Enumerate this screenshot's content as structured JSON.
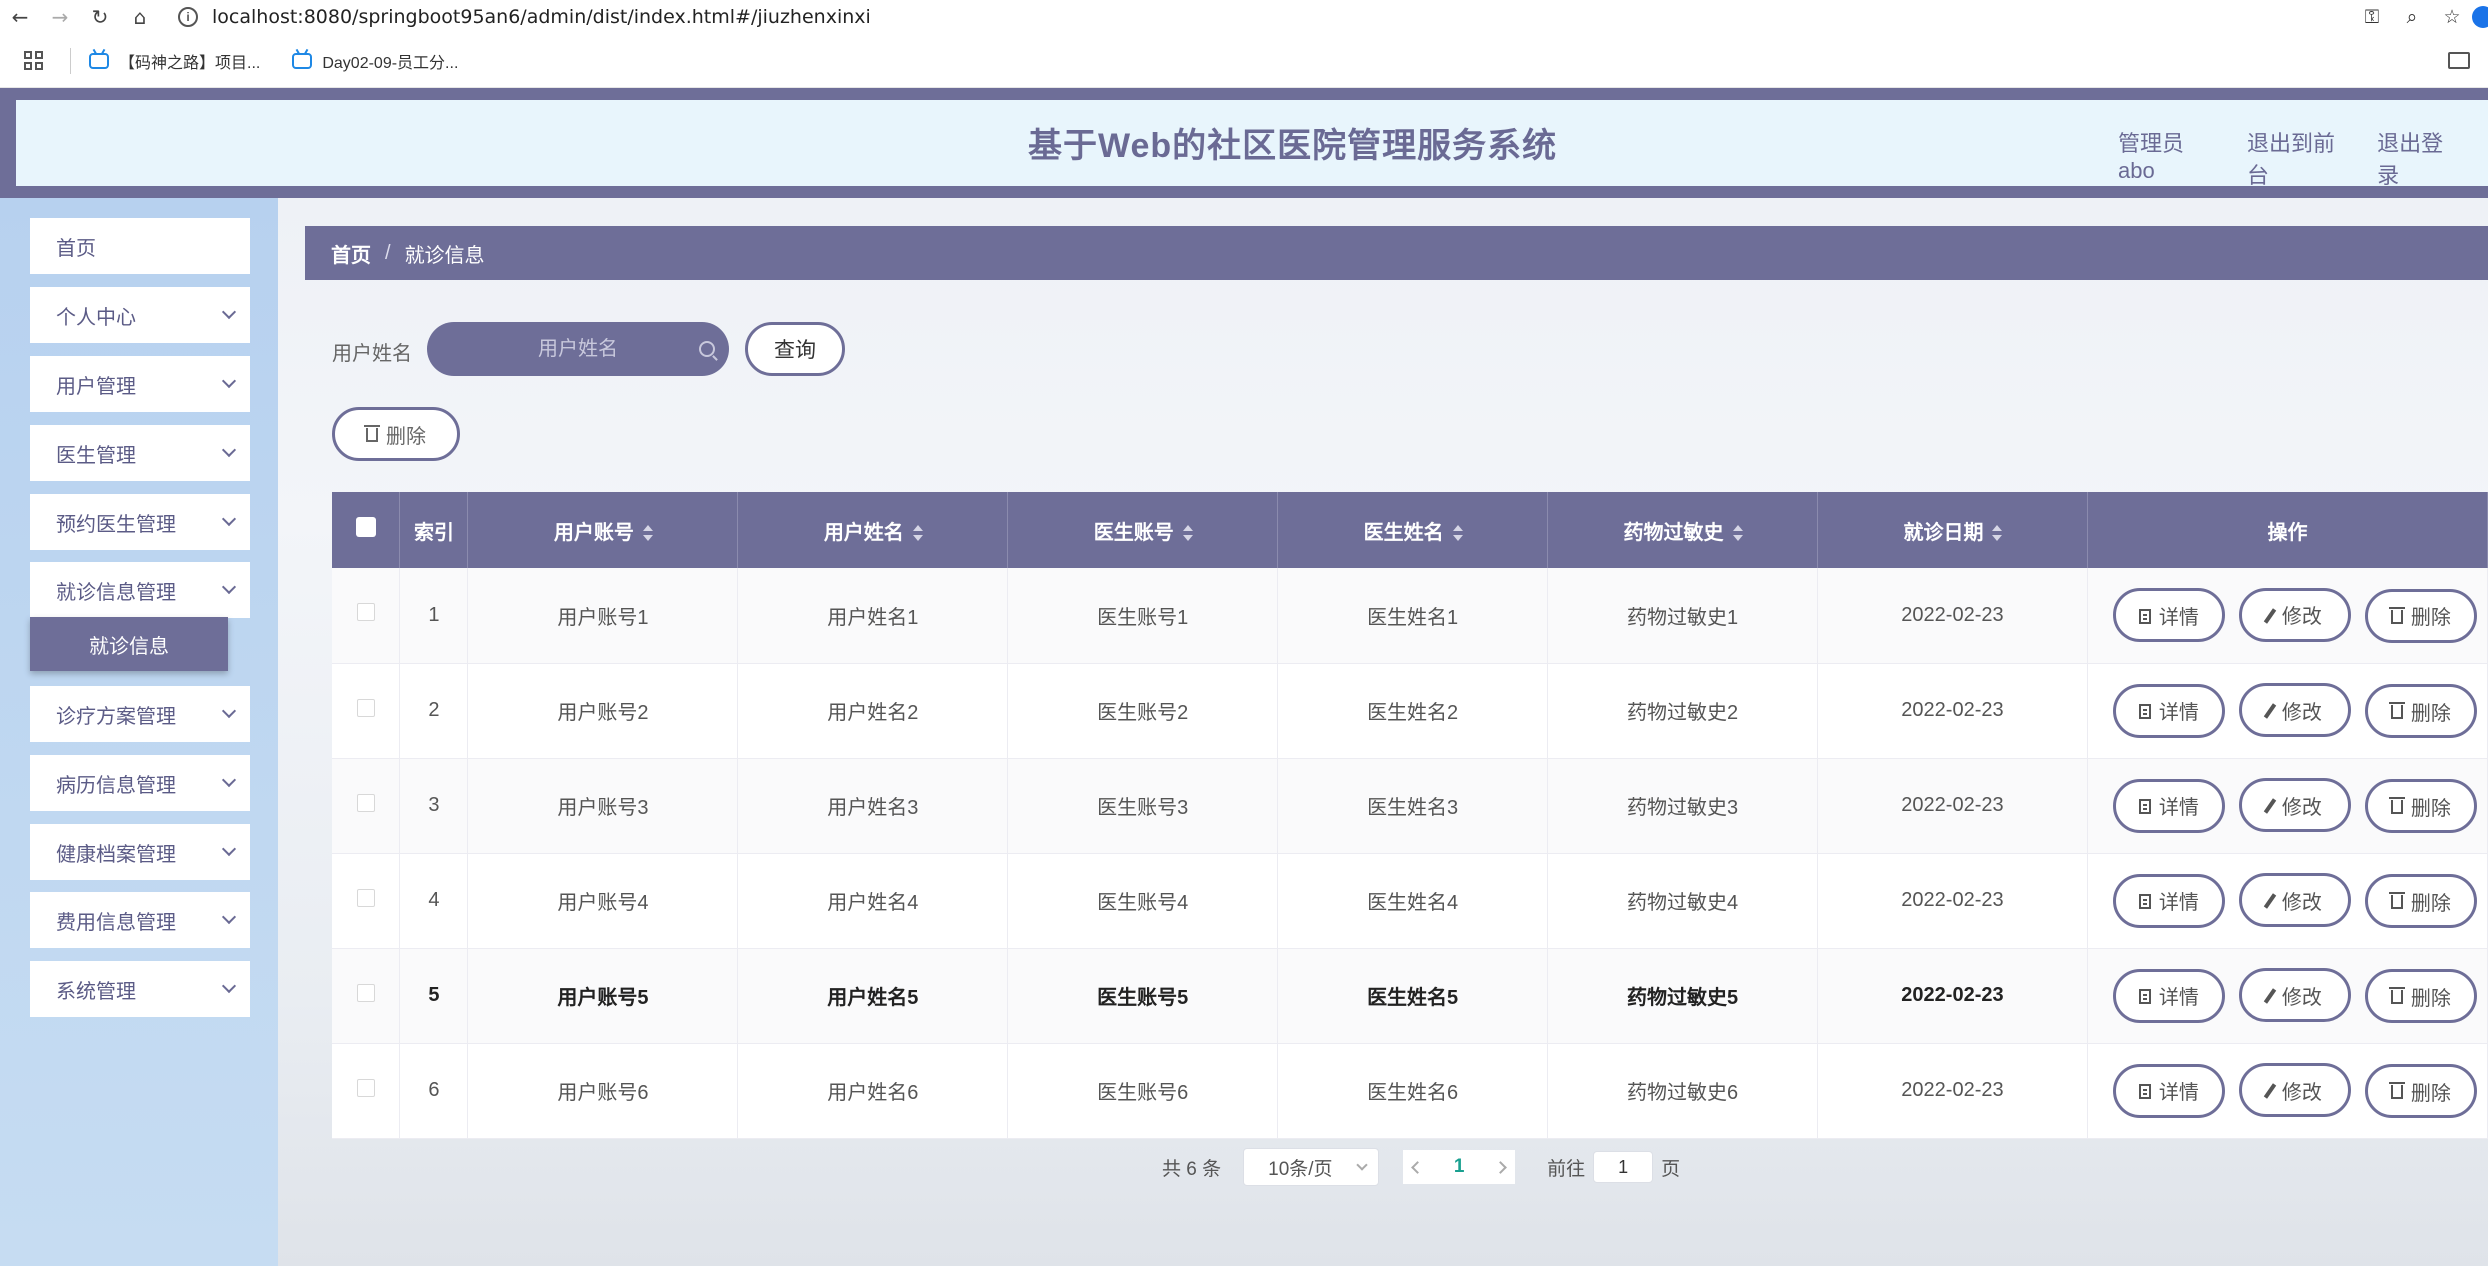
{
  "browser": {
    "url": "localhost:8080/springboot95an6/admin/dist/index.html#/jiuzhenxinxi",
    "bookmarks": [
      "【码神之路】项目...",
      "Day02-09-员工分..."
    ]
  },
  "header": {
    "title": "基于Web的社区医院管理服务系统",
    "admin": "管理员 abo",
    "to_front": "退出到前台",
    "logout": "退出登录"
  },
  "sidebar": {
    "items": [
      {
        "label": "首页"
      },
      {
        "label": "个人中心"
      },
      {
        "label": "用户管理"
      },
      {
        "label": "医生管理"
      },
      {
        "label": "预约医生管理"
      },
      {
        "label": "就诊信息管理"
      },
      {
        "label": "诊疗方案管理"
      },
      {
        "label": "病历信息管理"
      },
      {
        "label": "健康档案管理"
      },
      {
        "label": "费用信息管理"
      },
      {
        "label": "系统管理"
      }
    ],
    "active_sub": "就诊信息"
  },
  "breadcrumb": {
    "home": "首页",
    "sep": "/",
    "current": "就诊信息"
  },
  "search": {
    "label": "用户姓名",
    "placeholder": "用户姓名",
    "query_btn": "查询"
  },
  "actions": {
    "batch_delete": "删除"
  },
  "table": {
    "headers": [
      "索引",
      "用户账号",
      "用户姓名",
      "医生账号",
      "医生姓名",
      "药物过敏史",
      "就诊日期",
      "操作"
    ],
    "ops": {
      "detail": "详情",
      "edit": "修改",
      "delete": "删除"
    },
    "rows": [
      [
        "1",
        "用户账号1",
        "用户姓名1",
        "医生账号1",
        "医生姓名1",
        "药物过敏史1",
        "2022-02-23"
      ],
      [
        "2",
        "用户账号2",
        "用户姓名2",
        "医生账号2",
        "医生姓名2",
        "药物过敏史2",
        "2022-02-23"
      ],
      [
        "3",
        "用户账号3",
        "用户姓名3",
        "医生账号3",
        "医生姓名3",
        "药物过敏史3",
        "2022-02-23"
      ],
      [
        "4",
        "用户账号4",
        "用户姓名4",
        "医生账号4",
        "医生姓名4",
        "药物过敏史4",
        "2022-02-23"
      ],
      [
        "5",
        "用户账号5",
        "用户姓名5",
        "医生账号5",
        "医生姓名5",
        "药物过敏史5",
        "2022-02-23"
      ],
      [
        "6",
        "用户账号6",
        "用户姓名6",
        "医生账号6",
        "医生姓名6",
        "药物过敏史6",
        "2022-02-23"
      ]
    ]
  },
  "pagination": {
    "total": "共 6 条",
    "page_size": "10条/页",
    "current": "1",
    "goto_prefix": "前往",
    "goto_value": "1",
    "goto_suffix": "页"
  },
  "colors": {
    "accent": "#6e6e98",
    "header_bg": "#e8f5fc",
    "sidebar_bg": "#b7d1ef",
    "page_active": "#1aa090"
  }
}
